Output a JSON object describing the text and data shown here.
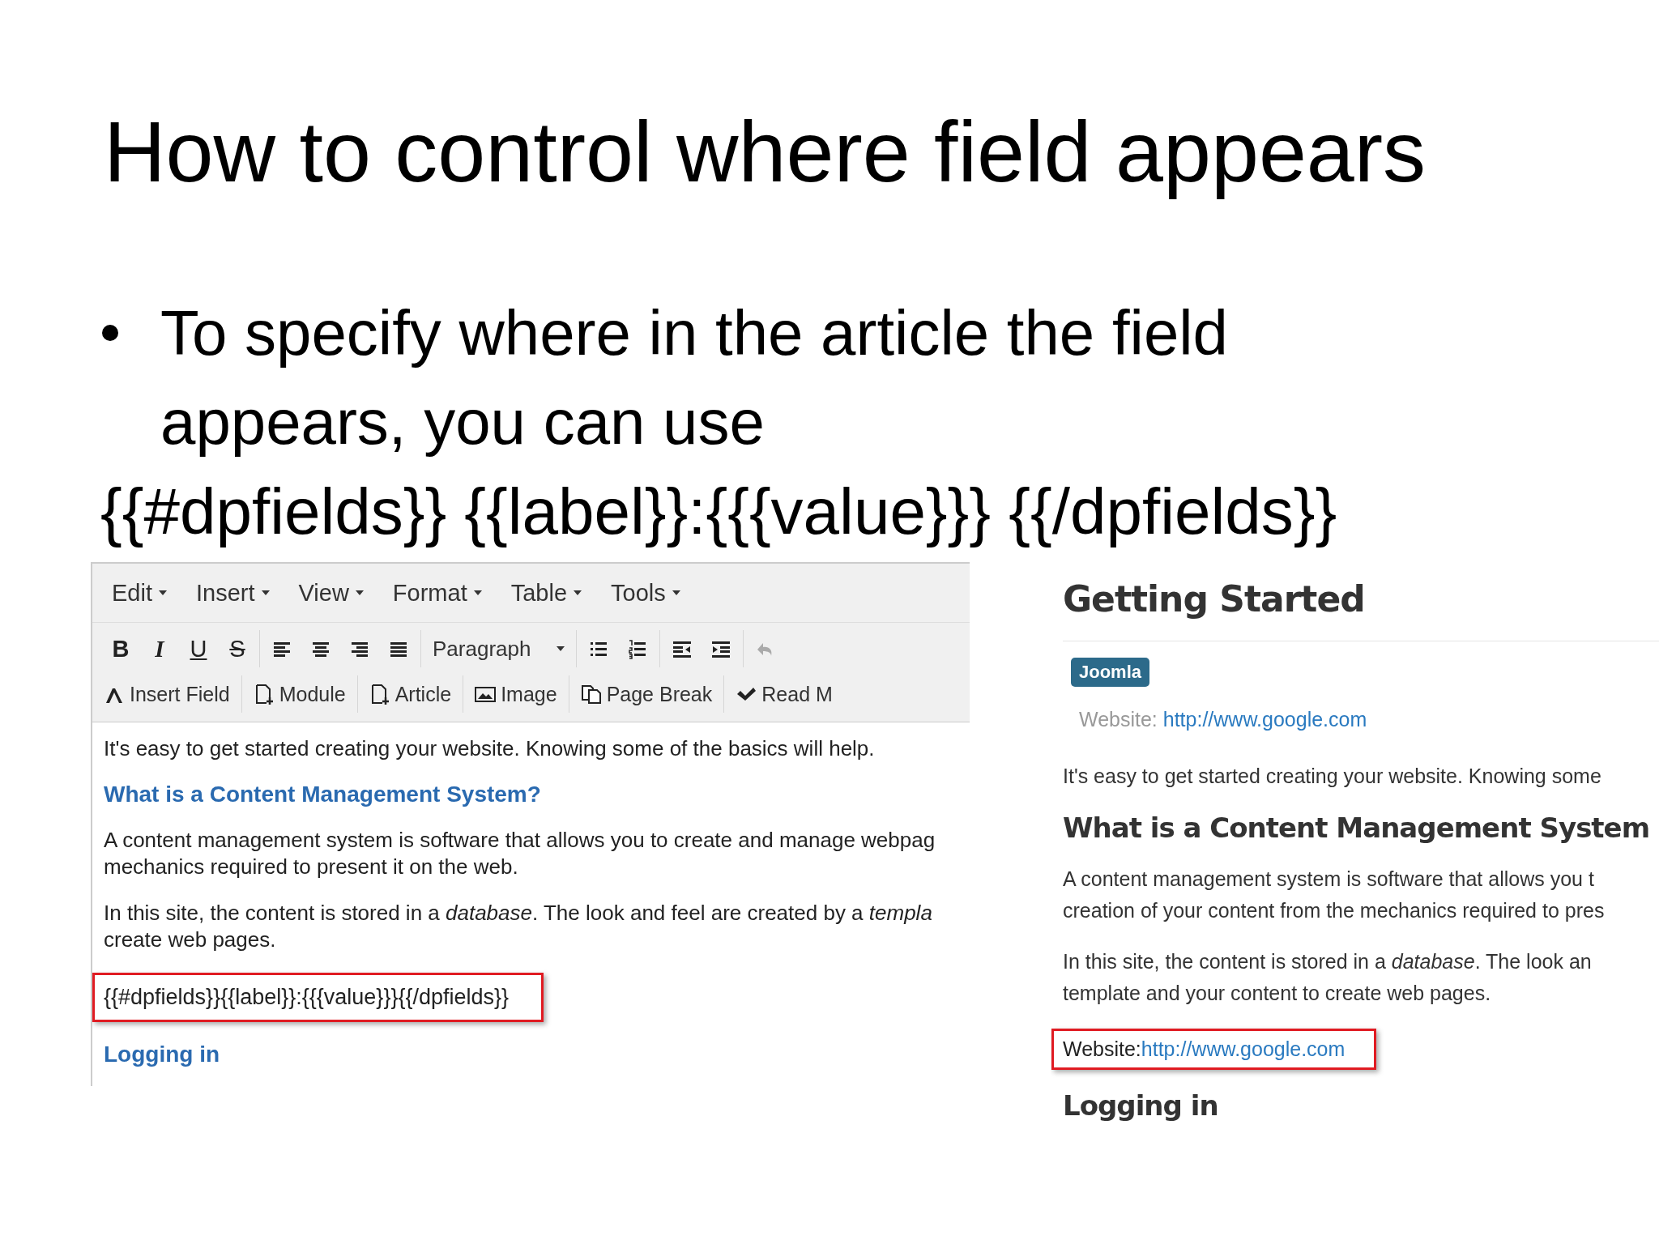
{
  "slide": {
    "title": "How to control where field appears",
    "bullet": "To specify where in the article the field appears, you can use",
    "code_line": "{{#dpfields}} {{label}}:{{{value}}} {{/dpfields}}"
  },
  "editor": {
    "menu": [
      "Edit",
      "Insert",
      "View",
      "Format",
      "Table",
      "Tools"
    ],
    "format_buttons": [
      {
        "kind": "bold",
        "glyph": "B"
      },
      {
        "kind": "italic",
        "glyph": "I"
      },
      {
        "kind": "underline",
        "glyph": "U"
      },
      {
        "kind": "strike",
        "glyph": "S"
      }
    ],
    "align_icons": [
      {
        "kind": "left"
      },
      {
        "kind": "center"
      },
      {
        "kind": "right"
      },
      {
        "kind": "justify"
      }
    ],
    "block_format": "Paragraph",
    "list_icons": [
      {
        "kind": "bullets"
      },
      {
        "kind": "numbers"
      },
      {
        "kind": "outdent"
      },
      {
        "kind": "indent"
      },
      {
        "kind": "undo"
      }
    ],
    "insert_buttons": [
      {
        "kind": "field",
        "label": "Insert Field"
      },
      {
        "kind": "module",
        "label": "Module"
      },
      {
        "kind": "article",
        "label": "Article"
      },
      {
        "kind": "image",
        "label": "Image"
      },
      {
        "kind": "pagebreak",
        "label": "Page Break"
      },
      {
        "kind": "readmore",
        "label": "Read M"
      }
    ],
    "body": [
      {
        "kind": "paragraph",
        "lines": [
          "It's easy to get started creating your website. Knowing some of the basics will help."
        ]
      },
      {
        "kind": "heading",
        "lines": [
          "What is a Content Management System?"
        ]
      },
      {
        "kind": "paragraph",
        "lines": [
          "A content management system is software that allows you to create and manage webpag",
          "mechanics required to present it on the web."
        ]
      },
      {
        "kind": "paragraph",
        "lines": [
          "In this site, the content is stored in a *database*. The look and feel are created by a *templa*",
          "create web pages."
        ]
      },
      {
        "kind": "highlight",
        "lines": [
          "{{#dpfields}}{{label}}:{{{value}}}{{/dpfields}}"
        ]
      },
      {
        "kind": "heading",
        "lines": [
          "Logging in"
        ]
      }
    ]
  },
  "preview": {
    "title": "Getting Started",
    "tag": "Joomla",
    "field": {
      "label": "Website:",
      "value": "http://www.google.com"
    },
    "body": [
      {
        "kind": "paragraph",
        "lines": [
          "It's easy to get started creating your website. Knowing some"
        ]
      },
      {
        "kind": "heading",
        "lines": [
          "What is a Content Management System"
        ]
      },
      {
        "kind": "paragraph",
        "lines": [
          "A content management system is software that allows you t",
          "creation of your content from the mechanics required to pres"
        ]
      },
      {
        "kind": "paragraph",
        "lines": [
          "In this site, the content is stored in a *database*. The look an",
          "template and your content to create web pages."
        ]
      },
      {
        "kind": "highlight",
        "label": "Website:",
        "value": "http://www.google.com"
      },
      {
        "kind": "heading",
        "lines": [
          "Logging in"
        ]
      }
    ]
  }
}
